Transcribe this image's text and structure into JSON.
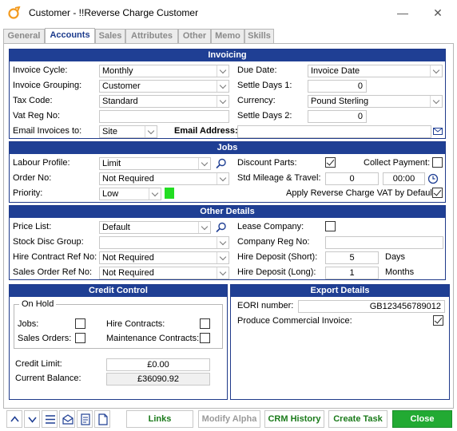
{
  "window": {
    "title": "Customer - !!Reverse Charge Customer"
  },
  "tabs": [
    {
      "label": "General"
    },
    {
      "label": "Accounts"
    },
    {
      "label": "Sales"
    },
    {
      "label": "Attributes"
    },
    {
      "label": "Other"
    },
    {
      "label": "Memo"
    },
    {
      "label": "Skills"
    }
  ],
  "invoicing": {
    "header": "Invoicing",
    "invoice_cycle_label": "Invoice Cycle:",
    "invoice_cycle": "Monthly",
    "invoice_grouping_label": "Invoice Grouping:",
    "invoice_grouping": "Customer",
    "tax_code_label": "Tax Code:",
    "tax_code": "Standard",
    "vat_reg_label": "Vat Reg No:",
    "vat_reg": "",
    "email_invoices_label": "Email Invoices to:",
    "email_invoices": "Site",
    "email_address_label": "Email Address:",
    "email_address": "",
    "due_date_label": "Due Date:",
    "due_date": "Invoice Date",
    "settle1_label": "Settle Days 1:",
    "settle1": "0",
    "currency_label": "Currency:",
    "currency": "Pound Sterling",
    "settle2_label": "Settle Days 2:",
    "settle2": "0"
  },
  "jobs": {
    "header": "Jobs",
    "labour_label": "Labour Profile:",
    "labour": "Limit",
    "order_label": "Order No:",
    "order": "Not Required",
    "priority_label": "Priority:",
    "priority": "Low",
    "discount_parts_label": "Discount Parts:",
    "discount_parts": true,
    "collect_payment_label": "Collect Payment:",
    "collect_payment": false,
    "mileage_label": "Std Mileage & Travel:",
    "mileage": "0",
    "travel": "00:00",
    "reverse_charge_label": "Apply Reverse Charge VAT by Default:",
    "reverse_charge": true,
    "priority_color": "#22dd22"
  },
  "other": {
    "header": "Other Details",
    "price_list_label": "Price List:",
    "price_list": "Default",
    "stock_disc_label": "Stock Disc Group:",
    "stock_disc": "",
    "hire_contract_label": "Hire Contract Ref No:",
    "hire_contract": "Not Required",
    "sales_order_label": "Sales Order Ref No:",
    "sales_order": "Not Required",
    "lease_label": "Lease Company:",
    "lease": false,
    "company_reg_label": "Company Reg No:",
    "company_reg": "",
    "deposit_short_label": "Hire Deposit (Short):",
    "deposit_short": "5",
    "deposit_short_unit": "Days",
    "deposit_long_label": "Hire Deposit (Long):",
    "deposit_long": "1",
    "deposit_long_unit": "Months"
  },
  "credit": {
    "header": "Credit Control",
    "on_hold_label": "On Hold",
    "jobs_label": "Jobs:",
    "jobs": false,
    "hire_contracts_label": "Hire Contracts:",
    "hire_contracts": false,
    "sales_orders_label": "Sales Orders:",
    "sales_orders": false,
    "maintenance_label": "Maintenance Contracts:",
    "maintenance": false,
    "limit_label": "Credit Limit:",
    "limit": "£0.00",
    "balance_label": "Current Balance:",
    "balance": "£36090.92"
  },
  "export": {
    "header": "Export Details",
    "eori_label": "EORI number:",
    "eori": "GB123456789012",
    "commercial_invoice_label": "Produce Commercial Invoice:",
    "commercial_invoice": true
  },
  "bottom": {
    "links": "Links",
    "modify_alpha": "Modify Alpha",
    "crm_history": "CRM History",
    "create_task": "Create Task",
    "close": "Close"
  },
  "colors": {
    "panel_header": "#1f3f94",
    "close_button": "#22aa33",
    "accent_text": "#1b3a8c"
  }
}
